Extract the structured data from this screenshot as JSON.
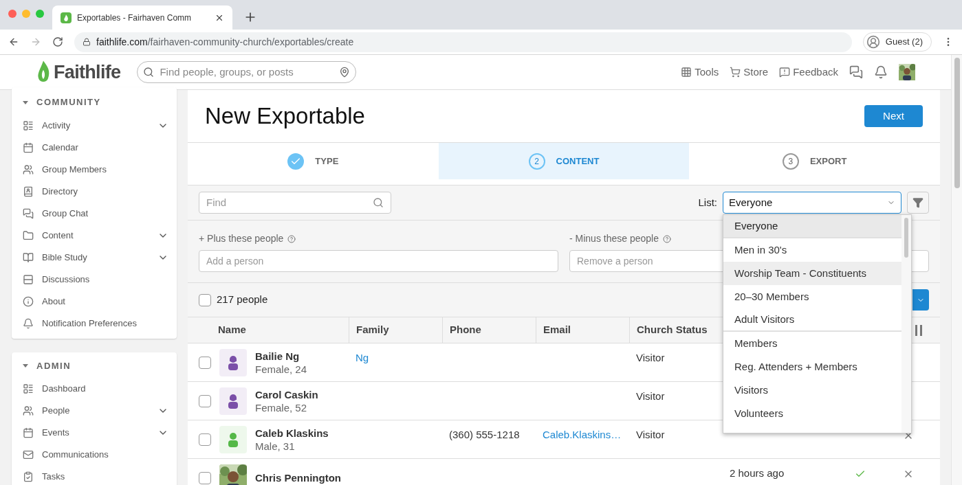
{
  "browser": {
    "tab_title": "Exportables - Fairhaven Comm",
    "url_host": "faithlife.com",
    "url_path": "/fairhaven-community-church/exportables/create",
    "profile": "Guest (2)"
  },
  "header": {
    "logo": "Faithlife",
    "search_placeholder": "Find people, groups, or posts",
    "nav": [
      {
        "kind": "tools",
        "label": "Tools"
      },
      {
        "kind": "store",
        "label": "Store"
      },
      {
        "kind": "feedback",
        "label": "Feedback"
      },
      {
        "kind": "chat"
      },
      {
        "kind": "notifications"
      },
      {
        "kind": "avatar"
      }
    ]
  },
  "sidebar": {
    "sections": [
      {
        "title": "COMMUNITY",
        "expanded": true,
        "items": [
          {
            "kind": "activity",
            "label": "Activity",
            "expandable": true
          },
          {
            "kind": "calendar",
            "label": "Calendar",
            "expandable": false
          },
          {
            "kind": "members",
            "label": "Group Members",
            "expandable": false
          },
          {
            "kind": "directory",
            "label": "Directory",
            "expandable": false
          },
          {
            "kind": "chat",
            "label": "Group Chat",
            "expandable": false
          },
          {
            "kind": "folder",
            "label": "Content",
            "expandable": true
          },
          {
            "kind": "bible",
            "label": "Bible Study",
            "expandable": true
          },
          {
            "kind": "discussions",
            "label": "Discussions",
            "expandable": false
          },
          {
            "kind": "info",
            "label": "About",
            "expandable": false
          },
          {
            "kind": "bell",
            "label": "Notification Preferences",
            "expandable": false
          }
        ]
      },
      {
        "title": "ADMIN",
        "expanded": true,
        "items": [
          {
            "kind": "activity",
            "label": "Dashboard",
            "expandable": false
          },
          {
            "kind": "members",
            "label": "People",
            "expandable": true
          },
          {
            "kind": "calendar",
            "label": "Events",
            "expandable": true
          },
          {
            "kind": "mail",
            "label": "Communications",
            "expandable": false
          },
          {
            "kind": "tasks",
            "label": "Tasks",
            "expandable": false
          }
        ]
      }
    ]
  },
  "page": {
    "title": "New Exportable",
    "next_button": "Next",
    "steps": [
      {
        "label": "TYPE",
        "done": true,
        "selected": false
      },
      {
        "label": "CONTENT",
        "number": "2",
        "done": false,
        "selected": true
      },
      {
        "label": "EXPORT",
        "number": "3",
        "done": false,
        "selected": false
      }
    ],
    "find_placeholder": "Find",
    "list_label": "List:",
    "list_value": "Everyone",
    "list_options": [
      {
        "label": "Everyone",
        "selected": true,
        "hovered": false,
        "divider_after": true
      },
      {
        "label": "Men in 30's",
        "selected": false,
        "hovered": false,
        "divider_after": false
      },
      {
        "label": "Worship Team - Constituents",
        "selected": false,
        "hovered": true,
        "divider_after": false
      },
      {
        "label": "20–30 Members",
        "selected": false,
        "hovered": false,
        "divider_after": false
      },
      {
        "label": "Adult Visitors",
        "selected": false,
        "hovered": false,
        "divider_after": true
      },
      {
        "label": "Members",
        "selected": false,
        "hovered": false,
        "divider_after": false
      },
      {
        "label": "Reg. Attenders + Members",
        "selected": false,
        "hovered": false,
        "divider_after": false
      },
      {
        "label": "Visitors",
        "selected": false,
        "hovered": false,
        "divider_after": false
      },
      {
        "label": "Volunteers",
        "selected": false,
        "hovered": false,
        "divider_after": false
      }
    ],
    "plus_label": "+ Plus these people",
    "plus_placeholder": "Add a person",
    "minus_label": "- Minus these people",
    "minus_placeholder": "Remove a person",
    "count_label": "217 people",
    "select_all_checked": false
  },
  "table": {
    "columns": [
      "Name",
      "Family",
      "Phone",
      "Email",
      "Church Status"
    ],
    "rows": [
      {
        "checked": false,
        "name": "Bailie Ng",
        "detail": "Female, 24",
        "kind": "female",
        "color": "#7b4fa8",
        "family": "Ng",
        "phone": "",
        "email": "",
        "church_status": "Visitor"
      },
      {
        "checked": false,
        "name": "Carol Caskin",
        "detail": "Female, 52",
        "kind": "female",
        "color": "#7b4fa8",
        "family": "",
        "phone": "",
        "email": "",
        "church_status": "Visitor"
      },
      {
        "checked": false,
        "name": "Caleb Klaskins",
        "detail": "Male, 31",
        "kind": "male",
        "color": "#55b848",
        "family": "",
        "phone": "(360) 555-1218",
        "email": "Caleb.Klaskins…",
        "church_status": "Visitor",
        "column_7_check": false,
        "removable": true
      },
      {
        "checked": false,
        "name": "Chris Pennington",
        "family": "",
        "phone": "",
        "email": "",
        "church_status": "",
        "column_6": "2 hours ago",
        "column_7_check": true,
        "removable": true
      }
    ]
  }
}
